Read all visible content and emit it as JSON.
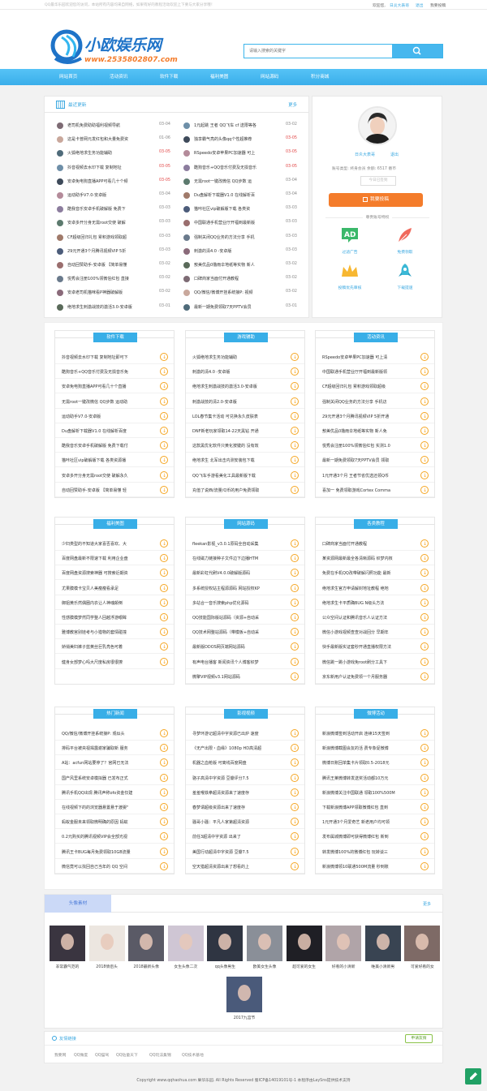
{
  "topbar": {
    "notice": "QQ最华乐园欢迎您的访问，本站所有内容均来自网络，如果有好的教程活动欢迎上下要与大家分享哦！",
    "welcome": "欢迎您,",
    "username": "日炎大表哥",
    "logout": "退出",
    "post": "我要投稿"
  },
  "logo": {
    "brand": "小欧娱乐网",
    "url": "www.2535802807.com"
  },
  "search": {
    "placeholder": "请输入搜索的关键字"
  },
  "nav": [
    "网站首页",
    "活动资讯",
    "软件下载",
    "福利美图",
    "网站源码",
    "积分商城"
  ],
  "recent": {
    "title": "最近更新",
    "more": "更多",
    "left": [
      {
        "t": "老司机免费助助福利视频导航",
        "d": "03-04",
        "red": false
      },
      {
        "t": "这是卡普网元发红包和大量免费资",
        "d": "01-06",
        "red": false
      },
      {
        "t": "火狐绝地求生务功能辅助",
        "d": "03-05",
        "red": true
      },
      {
        "t": "抖音视频去水印下载 复制地址",
        "d": "03-05",
        "red": true
      },
      {
        "t": "安卓免电狗直播APP可看几十个频",
        "d": "03-05",
        "red": true
      },
      {
        "t": "运动助手V7.0-安卓版",
        "d": "03-04",
        "red": false
      },
      {
        "t": "酷我音乐安卓手机破解版 免费下",
        "d": "03-03",
        "red": false
      },
      {
        "t": "安卓多开分身无需root交使 破解",
        "d": "03-03",
        "red": false
      },
      {
        "t": "CF超级回归礼包 累积游戏领取超",
        "d": "03-03",
        "red": false
      },
      {
        "t": "29元开通3个月腾讯视频VIP 5折",
        "d": "03-03",
        "red": false
      },
      {
        "t": "自动回赞助手-安卓版 【简单易懂",
        "d": "03-02",
        "red": false
      },
      {
        "t": "悦秀会注册100%领微信红包 直接",
        "d": "03-02",
        "red": false
      },
      {
        "t": "安卓老司机猫咪看P神器破解版",
        "d": "03-02",
        "red": false
      },
      {
        "t": "绝地求生刺激战技的激活3.0-安卓版",
        "d": "03-01",
        "red": false
      }
    ],
    "right": [
      {
        "t": "1元起跳 王者 QQ飞车 cf 送限等各",
        "d": "03-02",
        "red": false
      },
      {
        "t": "独享霸气亮的头像qq个性超推荐",
        "d": "03-05",
        "red": true
      },
      {
        "t": "RSpeedo安卓苹果PC加速器 可上",
        "d": "03-05",
        "red": true
      },
      {
        "t": "酷狗音乐+QQ音乐付费及无损音乐",
        "d": "03-05",
        "red": true
      },
      {
        "t": "无需root一键改微信 QQ步数 运",
        "d": "03-04",
        "red": false
      },
      {
        "t": "Du盘解析下载器V1.0 在线解析百",
        "d": "03-04",
        "red": false
      },
      {
        "t": "猫咔社区vip破解版下载 各类资",
        "d": "03-03",
        "red": false
      },
      {
        "t": "中国联通手机营业厅开福到最新版",
        "d": "03-03",
        "red": false
      },
      {
        "t": "强制关闭QQ业务的方法分享 手机",
        "d": "03-03",
        "red": false
      },
      {
        "t": "刺激的清4.0 -安卓版",
        "d": "03-03",
        "red": false
      },
      {
        "t": "敖美优品0撸雨伞地纸等实物 新人",
        "d": "03-02",
        "red": false
      },
      {
        "t": "口碑商家当面付开通教程",
        "d": "03-02",
        "red": false
      },
      {
        "t": "QQ/微信/微博开挂系统接P: 视频",
        "d": "03-02",
        "red": false
      },
      {
        "t": "最新一期免费领取7天PPTV会员",
        "d": "03-01",
        "red": false
      }
    ]
  },
  "user": {
    "name": "日炎大表哥",
    "logout": "退出",
    "account": "账号类型:  终身会员   余额:   6517 番币",
    "signed": "今日已签到",
    "post_btn": "我要投稿",
    "priv_title": "尊贵账号特权",
    "privs": [
      "过滤广告",
      "免费领取",
      "投稿优先审核",
      "下载提速"
    ]
  },
  "categories": [
    {
      "name": "软件下载",
      "items": [
        "抖音视频去水印下载 复制地址即可下",
        "酷狗音乐+QQ音乐付费及无损音乐免",
        "安卓免电狗直播APP可看几十个直播",
        "无需root一键改微信 QQ步数 运动助",
        "运动助手V7.0-安卓版",
        "Du盘解析下载器V1.0 在线解析百度",
        "酷我音乐安卓手机破解版 免费下载付",
        "猫咔社区vip破解版下载 各类资源播",
        "安卓多开分身无需root交使 破解永久",
        "自动回赞助手-安卓版 【简单易懂 轻"
      ]
    },
    {
      "name": "游戏辅助",
      "items": [
        "火狐绝地求生务功能辅助",
        "刺激的清4.0 -安卓版",
        "绝地求生刺激战技的激活3.0-安卓版",
        "刺激战技的清2.0-安卓版",
        "LOL春节集卡活动 可兑换永久皮肤表",
        "DNF新老玩家领取14-22天黑钻 开通",
        "这款黑优化软件只黄化按键的 没有效",
        "绝地求生 北军出击内测安装包下载",
        "QQ飞车手游看美化工具最新版下载",
        "充值了说西/流量/Q币的用户免费领取"
      ]
    },
    {
      "name": "活动资讯",
      "items": [
        "RSpeedo安卓苹果PC加速器 可上清",
        "中国联通手机营业厅开福到最新版领",
        "CF超级回归礼包 累积游戏领取超级",
        "强制关闭QQ业务的方法分享 手机访",
        "29元开通3个月腾讯视频VIP 5折开通",
        "敖美优品0撸雨伞地纸等实物 新人免",
        "悦秀会注册100%领微信红包 实测1.0",
        "最新一期免费领取7天PPTV会员 领取",
        "1元开通3个月 王者节省优选还领Q币",
        "喜加一 免费领取游戏Cortex Comma"
      ]
    },
    {
      "name": "福利美图",
      "items": [
        "少妇类型的不知道大家喜否喜欢、大",
        "百度网盘最新不限速下载 利用企业盘",
        "百度网盘资源搜索神器 可搜索近期资",
        "尤果膜模卡宝贝人美瘦瘦看承足",
        "御姐黄乐然偶圈内衣让人神魂颠倒",
        "性感膜模梦然同学整人回越浮游眼眸",
        "雅博教宫别娃考与小猎物的套情碰撞",
        "娇俏美妇裤子蓝黄丝巨乳亮色可着",
        "健身女部梦心吗大尺度私房很很撩"
      ]
    },
    {
      "name": "网站源码",
      "items": [
        "fleekan影视_v3.0.1原码全自动采集",
        "在线磁力链接种子文件边下边播HTM",
        "最新彩虹代刷V4.0.0破解版源码",
        "多系统授权站主程源源码 网站授权KP",
        "多站合一音乐搜索php优化源码",
        "QQ技能国际版站源码（资源+自动采",
        "QQ技术网整站源码（带模板+自动采",
        "最新版DDOS网页端网站源码",
        "有声电台播客 新闻资讯个人博客织梦",
        "微擎VIP视频v3.1网站源码"
      ]
    },
    {
      "name": "各类教程",
      "items": [
        "口碑商家当面付开通教程",
        "某资源网最新最全各清晰源码 织梦内核",
        "免费在手机QQ改带破解闪照功能 最新",
        "绝地求生官方申请解封地址教程 绝地",
        "绝地求生卡平质确BUG N级头方法",
        "公众空间认证和腾讯音乐人认证方法",
        "微信小游戏视频查查对战回分 早期年",
        "快手最新版实证套秒开通直播权限方法",
        "微信跳一跳小游戏免root刷分工具下",
        "京东新用户认证免费领一个月服务器"
      ]
    },
    {
      "name": "热门新闻",
      "items": [
        "QQ/微信/微博开挂系统接P: 观似头",
        "排码平台被央视揭露谢家骗取新 服务",
        "A站：acfun网站要停了？官网已无法",
        "国产风里系统安卓模拟器 已发布正式",
        "腾讯手机QQ出现 腾讯声称ofo资金仅建",
        "在线视频下的的浏览器悬置悬于渡婴\"",
        "蚂蚁金服未来领取微明确的原因 蚂蚁",
        "0.2元购买的腾讯视频VIP会全部光视",
        "腾讯王卡BUG每月免费领取10GB流量",
        "微信竟可以找回自己当年的 QQ 空间"
      ]
    },
    {
      "name": "影视视频",
      "items": [
        "寻梦环游记超清中字资源已出炉 速度",
        "《无产出限・血缘》1080p HD高清超",
        "机器之血枪版 可离线百度网盘",
        "骆子高清中字资源 豆瓣评分7.5",
        "羞羞哦铁拳超清资源来了速度存",
        "春梦谓超级资源出来了速度存",
        "骚哥小骚：平凡人家第超清资源",
        "前任3超清中字资源 出来了",
        "美国行动超清中字资源 豆瓣7.5",
        "空天猎超清资源出来了想看的上"
      ]
    },
    {
      "name": "微博活动",
      "items": [
        "新浪微博签到活动开启 连续15天签到",
        "新浪微博截图会友的活 费专象促微博",
        "微博日账回单集卡片领取0.5-2018元",
        "腾讯王莱微博转发送奖活动都10万元",
        "新浪微博关注中国联通 领取100%500M",
        "下载新浪微博APP领取微博红包 直到",
        "1元开通3个月爱奇艺 新老用户均可领",
        "发布属城微博即可获得微博红包 新到",
        "转发微博100%的微博红包 玩转谈三",
        "新浪微博领10联通500M流量 秒到账"
      ]
    }
  ],
  "avatars": {
    "title": "头像素材",
    "more": "更多",
    "items": [
      "非常霸气范的",
      "2018情侣头",
      "2018最新头像",
      "女生头像二次",
      "qq头像男生",
      "欧美女生头像",
      "超可爱的女生",
      "好看的小清新",
      "唯美小清新男",
      "可爱好看的女",
      "2017九宫节"
    ]
  },
  "friend_links": {
    "title": "友情链接",
    "apply": "申请友情",
    "links": [
      "我要网",
      "QQ微度",
      "QQ猫驾",
      "QQ钻童天下",
      "QQ玩法集锦",
      "QQ技术基地"
    ]
  },
  "footer": {
    "copyright": "Copyright www.qqhaohua.com 果华乐园. All Rights Reserved 蜀ICP备14019101号-1 本程序由LaySns提供技术支持"
  },
  "colors": {
    "accent": "#39a7e0",
    "orange": "#f47c2b",
    "red": "#e24545",
    "green": "#21a165"
  }
}
